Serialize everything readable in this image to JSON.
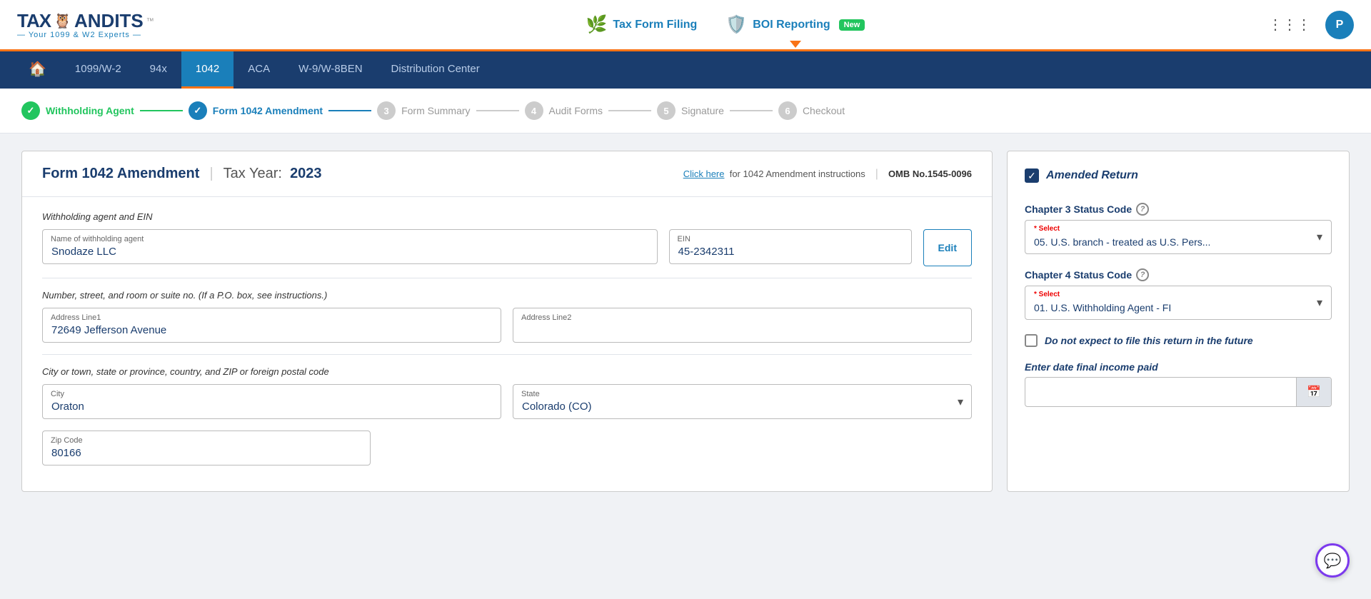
{
  "header": {
    "logo": {
      "tax": "TAX",
      "icon": "🦉",
      "andits": "ANDITS",
      "tm": "™",
      "sub": "— Your 1099 & W2 Experts —"
    },
    "nav": {
      "tax_filing_label": "Tax Form Filing",
      "boi_label": "BOI Reporting",
      "new_badge": "New"
    },
    "avatar_label": "P",
    "grid_icon": "⋮⋮⋮"
  },
  "nav_bar": {
    "items": [
      {
        "id": "home",
        "label": "🏠",
        "active": false
      },
      {
        "id": "1099",
        "label": "1099/W-2",
        "active": false
      },
      {
        "id": "94x",
        "label": "94x",
        "active": false
      },
      {
        "id": "1042",
        "label": "1042",
        "active": true
      },
      {
        "id": "aca",
        "label": "ACA",
        "active": false
      },
      {
        "id": "w9",
        "label": "W-9/W-8BEN",
        "active": false
      },
      {
        "id": "dist",
        "label": "Distribution Center",
        "active": false
      }
    ]
  },
  "steps": [
    {
      "id": "withholding-agent",
      "label": "Withholding Agent",
      "state": "done",
      "number": "✓"
    },
    {
      "id": "form-1042-amendment",
      "label": "Form 1042 Amendment",
      "state": "active",
      "number": "✓"
    },
    {
      "id": "form-summary",
      "label": "Form Summary",
      "state": "inactive",
      "number": "3"
    },
    {
      "id": "audit-forms",
      "label": "Audit Forms",
      "state": "inactive",
      "number": "4"
    },
    {
      "id": "signature",
      "label": "Signature",
      "state": "inactive",
      "number": "5"
    },
    {
      "id": "checkout",
      "label": "Checkout",
      "state": "inactive",
      "number": "6"
    }
  ],
  "form": {
    "title": "Form 1042 Amendment",
    "sep": "|",
    "tax_year_label": "Tax Year:",
    "tax_year": "2023",
    "instructions_prefix": "Click here",
    "instructions_suffix": "for 1042 Amendment instructions",
    "omb": "OMB No.1545-0096",
    "section1_label": "Withholding agent and EIN",
    "agent_name_label": "Name of withholding agent",
    "agent_name_value": "Snodaze LLC",
    "ein_label": "EIN",
    "ein_value": "45-2342311",
    "edit_label": "Edit",
    "section2_label": "Number, street, and room or suite no. (If a P.O. box, see instructions.)",
    "address1_label": "Address Line1",
    "address1_value": "72649 Jefferson Avenue",
    "address2_label": "Address Line2",
    "address2_value": "",
    "section3_label": "City or town, state or province, country, and ZIP or foreign postal code",
    "city_label": "City",
    "city_value": "Oraton",
    "state_label": "State",
    "state_value": "Colorado (CO)",
    "zip_label": "Zip Code",
    "zip_value": "80166"
  },
  "right_panel": {
    "amended_label": "Amended Return",
    "chapter3_label": "Chapter 3 Status Code",
    "chapter3_select_req": "* Select",
    "chapter3_value": "05. U.S. branch - treated as U.S. Pers...",
    "chapter4_label": "Chapter 4 Status Code",
    "chapter4_select_req": "* Select",
    "chapter4_value": "01. U.S. Withholding Agent - FI",
    "no_future_label": "Do not expect to file this return in the future",
    "date_label": "Enter date final income paid"
  }
}
